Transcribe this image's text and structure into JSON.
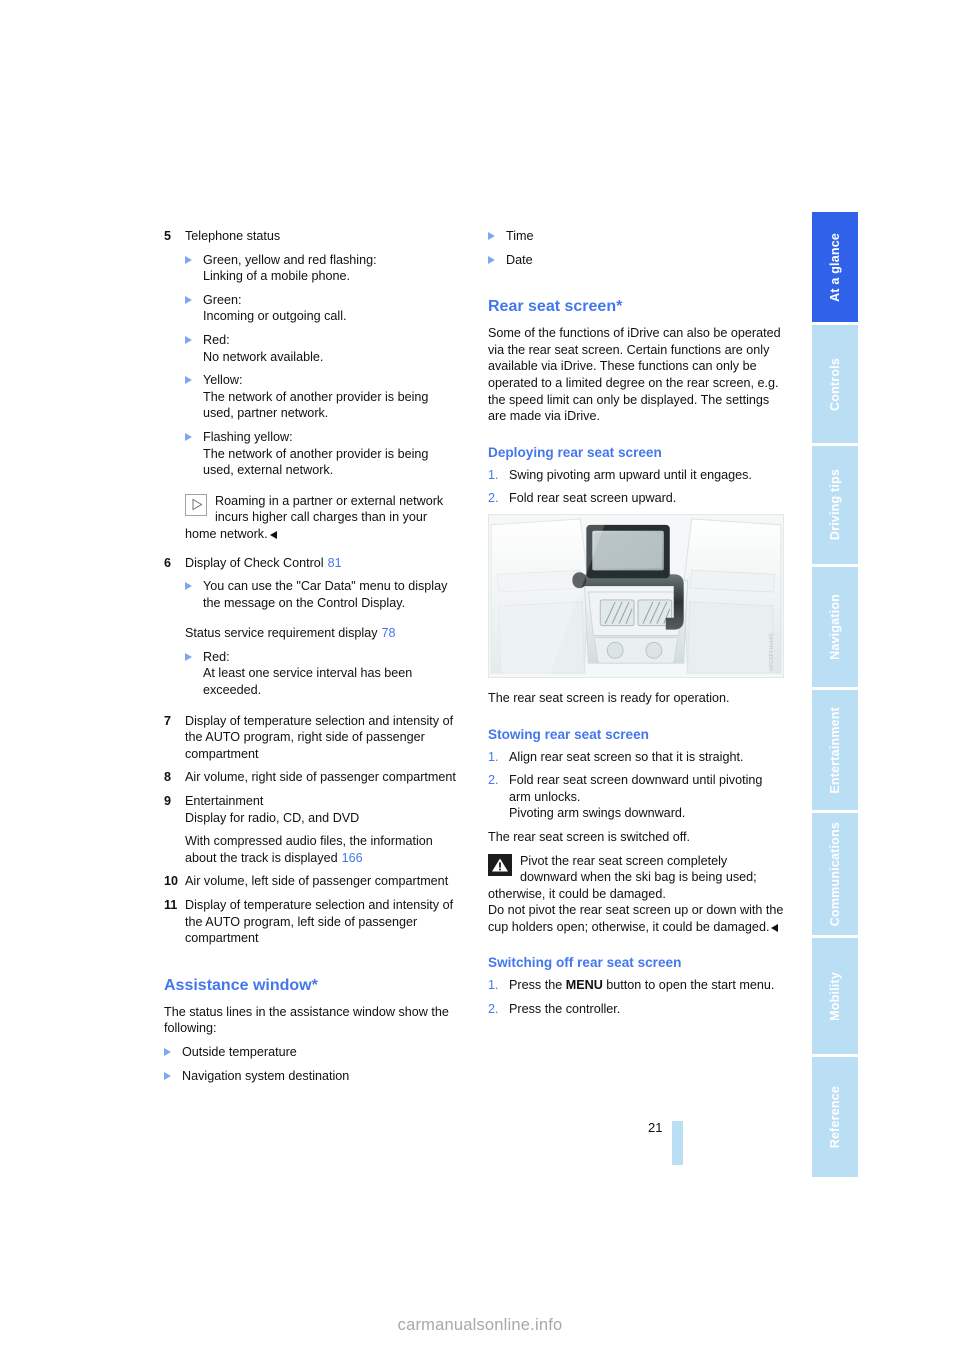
{
  "document": {
    "page_number": "21",
    "watermark": "carmanualsonline.info"
  },
  "tabs": [
    {
      "label": "At a glance",
      "active": true
    },
    {
      "label": "Controls",
      "active": false
    },
    {
      "label": "Driving tips",
      "active": false
    },
    {
      "label": "Navigation",
      "active": false
    },
    {
      "label": "Entertainment",
      "active": false
    },
    {
      "label": "Communications",
      "active": false
    },
    {
      "label": "Mobility",
      "active": false
    },
    {
      "label": "Reference",
      "active": false
    }
  ],
  "colors": {
    "heading_blue": "#4477ee",
    "tab_active": "#2f62e8",
    "tab_inactive": "#badff5",
    "bullet_blue": "#7ea8ee"
  },
  "left_column": {
    "item5": {
      "number": "5",
      "title": "Telephone status",
      "bullets": [
        "Green, yellow and red flashing:\nLinking of a mobile phone.",
        "Green:\nIncoming or outgoing call.",
        "Red:\nNo network available.",
        "Yellow:\nThe network of another provider is being used, partner network.",
        "Flashing yellow:\nThe network of another provider is being used, external network."
      ],
      "note": "Roaming in a partner or external network incurs higher call charges than in your home network."
    },
    "item6": {
      "number": "6",
      "title": "Display of Check Control",
      "page_ref": "81",
      "bullets": [
        "You can use the \"Car Data\" menu to display the message on the Control Display."
      ],
      "status_line": "Status service requirement display",
      "status_page_ref": "78",
      "status_bullets": [
        "Red:\nAt least one service interval has been exceeded."
      ]
    },
    "item7": {
      "number": "7",
      "title": "Display of temperature selection and intensity of the AUTO program, right side of passenger compartment"
    },
    "item8": {
      "number": "8",
      "title": "Air volume, right side of passenger compartment"
    },
    "item9": {
      "number": "9",
      "title": "Entertainment",
      "line2": "Display for radio, CD, and DVD",
      "line3": "With compressed audio files, the information about the track is displayed",
      "page_ref": "166"
    },
    "item10": {
      "number": "10",
      "title": "Air volume, left side of passenger compartment"
    },
    "item11": {
      "number": "11",
      "title": "Display of temperature selection and intensity of the AUTO program, left side of passenger compartment"
    },
    "assistance": {
      "heading": "Assistance window*",
      "intro": "The status lines in the assistance window show the following:",
      "bullets": [
        "Outside temperature",
        "Navigation system destination"
      ]
    }
  },
  "right_column": {
    "top_bullets": [
      "Time",
      "Date"
    ],
    "rear_seat_screen": {
      "heading": "Rear seat screen*",
      "intro": "Some of the functions of iDrive can also be operated via the rear seat screen. Certain functions are only available via iDrive. These functions can only be operated to a limited degree on the rear screen, e.g. the speed limit can only be displayed. The settings are made via iDrive."
    },
    "deploying": {
      "heading": "Deploying rear seat screen",
      "steps": [
        "Swing pivoting arm upward until it engages.",
        "Fold rear seat screen upward."
      ],
      "figure_caption": "",
      "figure_credit": "VPC5P1HIA4S",
      "after_text": "The rear seat screen is ready for operation."
    },
    "stowing": {
      "heading": "Stowing rear seat screen",
      "steps": [
        "Align rear seat screen so that it is straight.",
        "Fold rear seat screen downward until pivoting arm unlocks.\nPivoting arm swings downward."
      ],
      "after_text": "The rear seat screen is switched off.",
      "warning_line1": "Pivot the rear seat screen completely downward when the ski bag is being used; otherwise, it could be damaged.",
      "warning_line2": "Do not pivot the rear seat screen up or down with the cup holders open; otherwise, it could be damaged."
    },
    "switching_off": {
      "heading": "Switching off rear seat screen",
      "step1_pre": "Press the ",
      "step1_menu": "MENU",
      "step1_post": " button to open the start menu.",
      "step2": "Press the controller."
    }
  }
}
